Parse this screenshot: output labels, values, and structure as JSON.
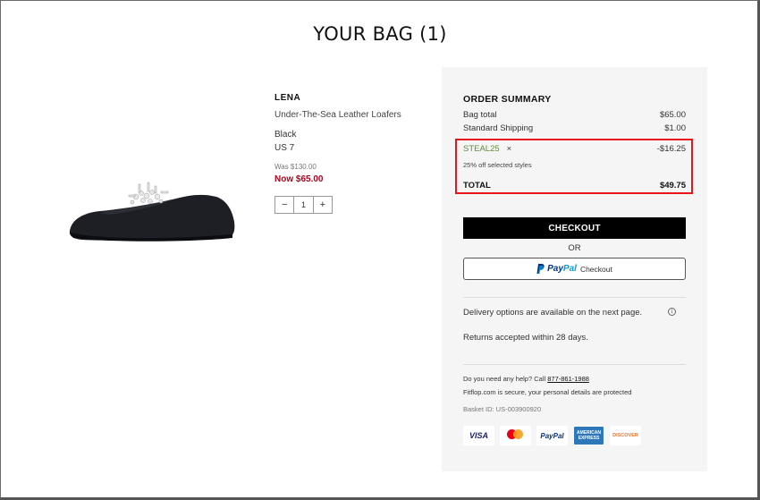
{
  "page": {
    "title": "YOUR BAG (1)"
  },
  "product": {
    "name": "LENA",
    "description": "Under-The-Sea Leather Loafers",
    "color": "Black",
    "size": "US 7",
    "was_price": "Was $130.00",
    "now_price": "Now $65.00",
    "quantity": "1",
    "qty_minus": "−",
    "qty_plus": "+"
  },
  "summary": {
    "title": "ORDER SUMMARY",
    "bag_total_label": "Bag total",
    "bag_total_value": "$65.00",
    "shipping_label": "Standard Shipping",
    "shipping_value": "$1.00",
    "promo_code": "STEAL25",
    "promo_remove": "×",
    "promo_value": "-$16.25",
    "promo_description": "25% off selected styles",
    "total_label": "TOTAL",
    "total_value": "$49.75"
  },
  "actions": {
    "checkout_label": "CHECKOUT",
    "or_label": "OR",
    "paypal_p": "Pay",
    "paypal_pal": "Pal",
    "paypal_checkout": "Checkout"
  },
  "info": {
    "delivery": "Delivery options are available on the next page.",
    "info_icon": "i",
    "returns": "Returns accepted within 28 days.",
    "help_prefix": "Do you need any help? Call ",
    "help_phone": "877-861-1988",
    "secure": "Fitflop.com is secure, your personal details are protected",
    "basket_id": "Basket ID: US-003900920"
  },
  "payment_methods": {
    "visa": "VISA",
    "paypal": "PayPal",
    "amex_line1": "AMERICAN",
    "amex_line2": "EXPRESS",
    "discover_a": "DISC",
    "discover_o": "O",
    "discover_b": "VER"
  },
  "colors": {
    "accent_red": "#b3001b",
    "promo_green": "#5e8a3a",
    "highlight_border": "#e8141c",
    "panel_bg": "#f5f5f5"
  }
}
